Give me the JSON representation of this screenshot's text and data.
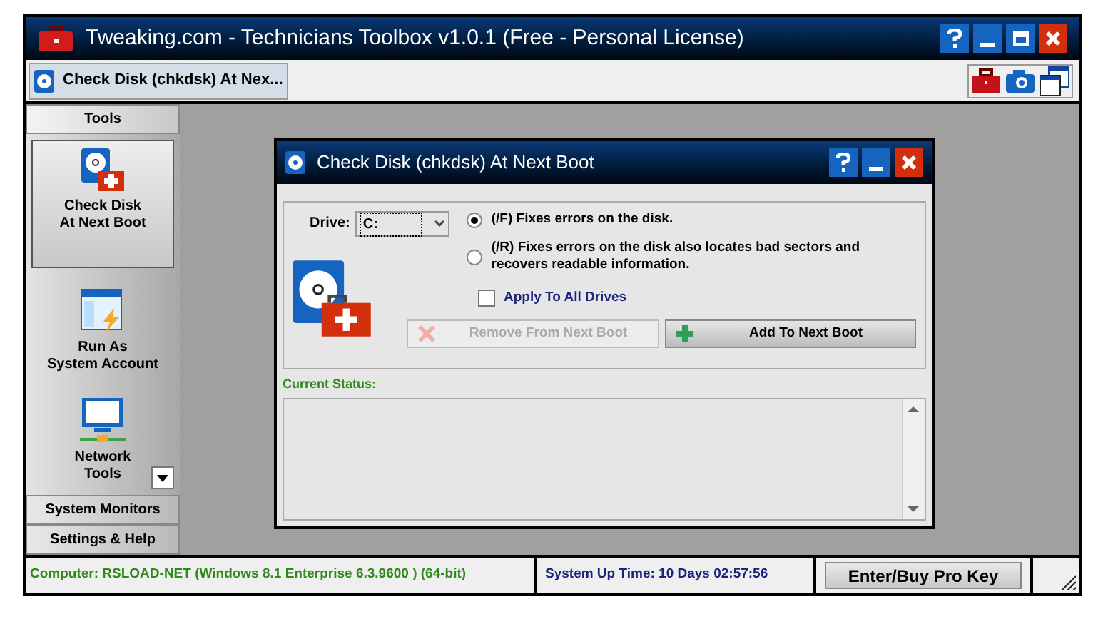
{
  "window": {
    "title": "Tweaking.com - Technicians Toolbox v1.0.1 (Free - Personal License)"
  },
  "tab": {
    "label": "Check Disk (chkdsk) At Nex..."
  },
  "sidebar": {
    "sections": [
      {
        "label": "Tools",
        "selected": true
      },
      {
        "label": "System Monitors",
        "selected": false
      },
      {
        "label": "Settings & Help",
        "selected": false
      }
    ],
    "tools": [
      {
        "kind": "disk",
        "lines": [
          "Check Disk",
          "At Next Boot"
        ],
        "selected": true
      },
      {
        "kind": "run",
        "lines": [
          "Run As",
          "System Account"
        ],
        "selected": false
      },
      {
        "kind": "network",
        "lines": [
          "Network",
          "Tools"
        ],
        "selected": false
      }
    ]
  },
  "dialog": {
    "title": "Check Disk (chkdsk) At Next Boot",
    "drive_label": "Drive:",
    "drive_value": "C:",
    "options": [
      {
        "label": "(/F) Fixes errors on the disk.",
        "selected": true
      },
      {
        "label": "(/R) Fixes errors on the disk also locates bad sectors and recovers readable information.",
        "selected": false
      }
    ],
    "apply_all": {
      "label": "Apply To All Drives",
      "checked": false
    },
    "buttons": [
      {
        "kind": "remove",
        "label": "Remove From Next Boot",
        "disabled": true
      },
      {
        "kind": "add",
        "label": "Add To Next Boot",
        "disabled": false
      }
    ],
    "status_label": "Current Status:"
  },
  "status_bar": {
    "computer": "Computer: RSLOAD-NET (Windows 8.1 Enterprise 6.3.9600 ) (64-bit)",
    "uptime": "System Up Time: 10 Days 02:57:56",
    "pro_key": "Enter/Buy Pro Key"
  }
}
